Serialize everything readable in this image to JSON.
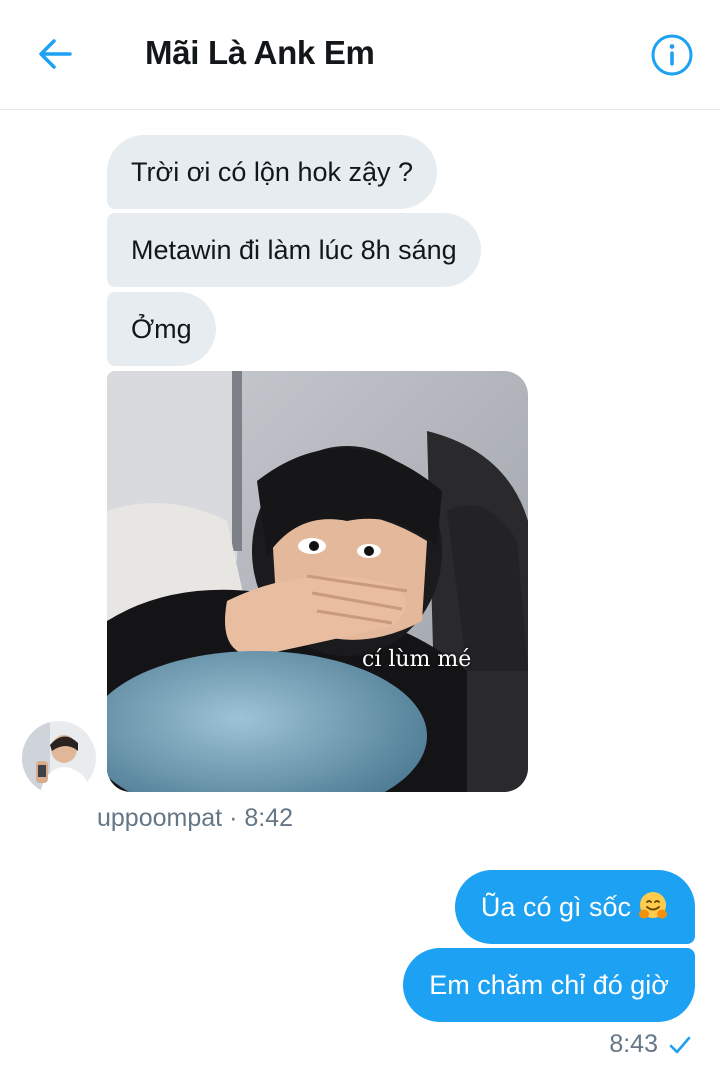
{
  "header": {
    "title": "Mãi Là Ank Em",
    "back_icon": "arrow-left-icon",
    "info_icon": "info-icon"
  },
  "colors": {
    "accent": "#1da1f2",
    "incoming_bubble": "#e6ecf0",
    "muted_text": "#657786"
  },
  "conversation": {
    "incoming": {
      "messages": [
        "Trời ơi có lộn hok zậy ?",
        "Metawin đi làm lúc 8h sáng",
        "Ởmg"
      ],
      "image": {
        "caption": "cí lùm mé"
      },
      "sender": "uppoompat",
      "separator": "·",
      "time": "8:42"
    },
    "outgoing": {
      "messages": [
        "Ũa có gì sốc",
        "Em chăm chỉ đó giờ"
      ],
      "emoji_icon": "hugging-face-icon",
      "time": "8:43",
      "status_icon": "checkmark-icon"
    }
  }
}
